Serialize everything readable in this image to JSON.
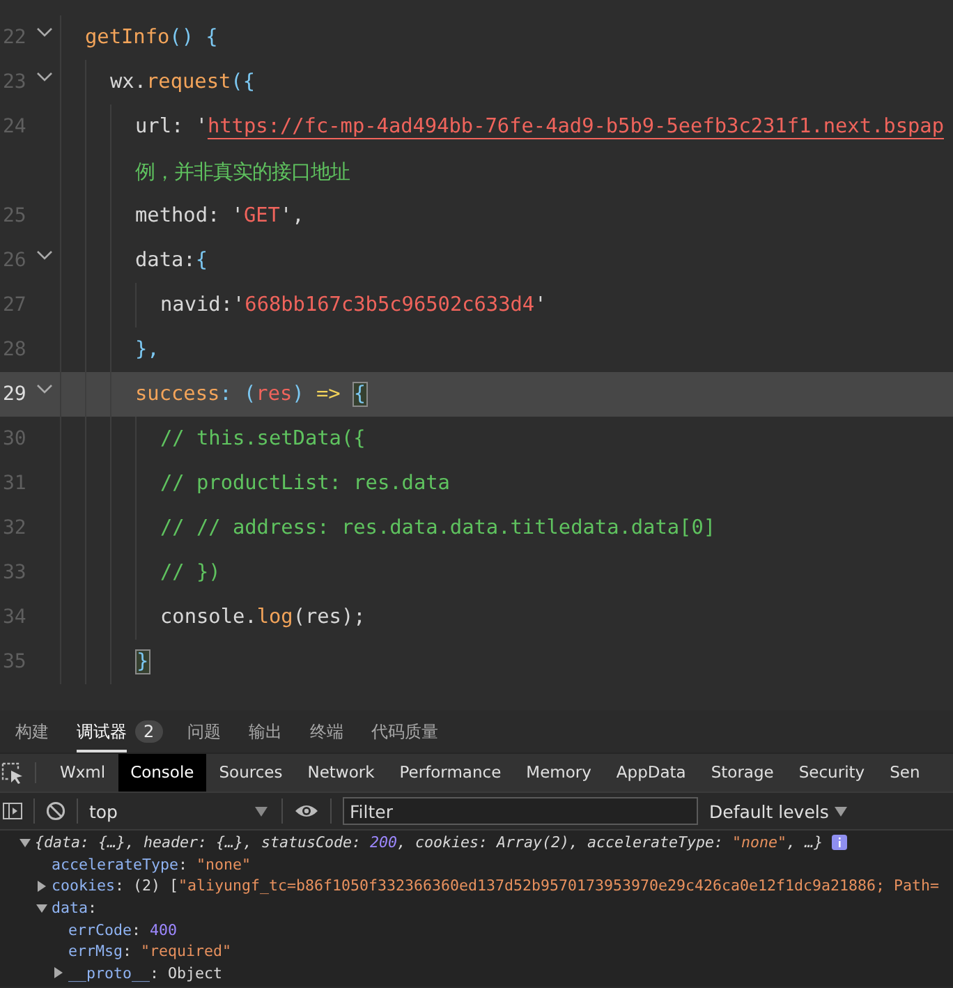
{
  "editor": {
    "lines": [
      {
        "number": "22",
        "fold": true,
        "current": false,
        "tokens": [
          {
            "kind": "fn",
            "text": "getInfo"
          },
          {
            "kind": "punct",
            "text": "() {"
          }
        ],
        "children": [
          {
            "number": "23",
            "fold": true,
            "current": false,
            "tokens": [
              {
                "kind": "plain",
                "text": "wx."
              },
              {
                "kind": "fn",
                "text": "request"
              },
              {
                "kind": "punct",
                "text": "({"
              }
            ],
            "children": [
              {
                "number": "24",
                "fold": false,
                "current": false,
                "tokens": [
                  {
                    "kind": "plain",
                    "text": "url: '"
                  },
                  {
                    "kind": "link",
                    "text": "https://fc-mp-4ad494bb-76fe-4ad9-b5b9-5eefb3c231f1.next.bspap"
                  }
                ]
              },
              {
                "fold": false,
                "current": false,
                "tokens": [
                  {
                    "kind": "comment",
                    "text": "例，并非真实的接口地址"
                  }
                ]
              },
              {
                "number": "25",
                "fold": false,
                "current": false,
                "tokens": [
                  {
                    "kind": "plain",
                    "text": "method: '"
                  },
                  {
                    "kind": "str",
                    "text": "GET"
                  },
                  {
                    "kind": "plain",
                    "text": "',"
                  }
                ]
              },
              {
                "number": "26",
                "fold": true,
                "current": false,
                "tokens": [
                  {
                    "kind": "plain",
                    "text": "data:"
                  },
                  {
                    "kind": "punct",
                    "text": "{"
                  }
                ],
                "children": [
                  {
                    "number": "27",
                    "fold": false,
                    "current": false,
                    "tokens": [
                      {
                        "kind": "plain",
                        "text": "navid:'"
                      },
                      {
                        "kind": "str",
                        "text": "668bb167c3b5c96502c633d4"
                      },
                      {
                        "kind": "plain",
                        "text": "'"
                      }
                    ]
                  }
                ]
              },
              {
                "number": "28",
                "fold": false,
                "current": false,
                "tokens": [
                  {
                    "kind": "punct",
                    "text": "},"
                  }
                ]
              },
              {
                "number": "29",
                "fold": true,
                "current": true,
                "tokens": [
                  {
                    "kind": "fn",
                    "text": "success"
                  },
                  {
                    "kind": "punct",
                    "text": ": ("
                  },
                  {
                    "kind": "str",
                    "text": "res"
                  },
                  {
                    "kind": "punct",
                    "text": ")"
                  },
                  {
                    "kind": "arrow",
                    "text": "=>"
                  },
                  {
                    "kind": "match",
                    "text": "{"
                  }
                ],
                "children": [
                  {
                    "number": "30",
                    "fold": false,
                    "current": false,
                    "tokens": [
                      {
                        "kind": "comment",
                        "text": "// this.setData({"
                      }
                    ]
                  },
                  {
                    "number": "31",
                    "fold": false,
                    "current": false,
                    "tokens": [
                      {
                        "kind": "comment",
                        "text": "//   productList: res.data"
                      }
                    ]
                  },
                  {
                    "number": "32",
                    "fold": false,
                    "current": false,
                    "tokens": [
                      {
                        "kind": "comment",
                        "text": "//   // address: res.data.data.titledata.data[0]"
                      }
                    ]
                  },
                  {
                    "number": "33",
                    "fold": false,
                    "current": false,
                    "tokens": [
                      {
                        "kind": "comment",
                        "text": "// })"
                      }
                    ]
                  },
                  {
                    "number": "34",
                    "fold": false,
                    "current": false,
                    "tokens": [
                      {
                        "kind": "plain",
                        "text": "console."
                      },
                      {
                        "kind": "fn",
                        "text": "log"
                      },
                      {
                        "kind": "plain",
                        "text": "(res);"
                      }
                    ]
                  }
                ]
              },
              {
                "number": "35",
                "fold": false,
                "current": false,
                "tokens": [
                  {
                    "kind": "match",
                    "text": "}"
                  }
                ]
              }
            ]
          }
        ]
      }
    ]
  },
  "panel_tabs": [
    {
      "label": "构建",
      "selected": false
    },
    {
      "label": "调试器",
      "selected": true,
      "badge": "2"
    },
    {
      "label": "问题",
      "selected": false
    },
    {
      "label": "输出",
      "selected": false
    },
    {
      "label": "终端",
      "selected": false
    },
    {
      "label": "代码质量",
      "selected": false
    }
  ],
  "devtools_tabs": [
    {
      "label": "Wxml",
      "selected": false
    },
    {
      "label": "Console",
      "selected": true
    },
    {
      "label": "Sources",
      "selected": false
    },
    {
      "label": "Network",
      "selected": false
    },
    {
      "label": "Performance",
      "selected": false
    },
    {
      "label": "Memory",
      "selected": false
    },
    {
      "label": "AppData",
      "selected": false
    },
    {
      "label": "Storage",
      "selected": false
    },
    {
      "label": "Security",
      "selected": false
    },
    {
      "label": "Sen",
      "selected": false
    }
  ],
  "toolbar": {
    "context": "top",
    "filter": {
      "placeholder": "Filter"
    },
    "levels": "Default levels"
  },
  "console": [
    {
      "expanded": true,
      "italic": true,
      "info": true,
      "tokens": [
        {
          "kind": "plain",
          "text": "{data: {…}, header: {…}, statusCode: "
        },
        {
          "kind": "num",
          "text": "200"
        },
        {
          "kind": "plain",
          "text": ", cookies: Array(2), accelerateType: "
        },
        {
          "kind": "str",
          "text": "\"none\""
        },
        {
          "kind": "plain",
          "text": ", …}"
        }
      ],
      "children": [
        {
          "key": "accelerateType",
          "tokens": [
            {
              "kind": "plain",
              "text": ": "
            },
            {
              "kind": "str",
              "text": "\"none\""
            }
          ]
        },
        {
          "expanded": false,
          "key": "cookies",
          "tokens": [
            {
              "kind": "plain",
              "text": ": (2) ["
            },
            {
              "kind": "str",
              "text": "\"aliyungf_tc=b86f1050f332366360ed137d52b9570173953970e29c426ca0e12f1dc9a21886; Path="
            }
          ]
        },
        {
          "expanded": true,
          "key": "data",
          "tokens": [
            {
              "kind": "plain",
              "text": ":"
            }
          ],
          "children": [
            {
              "key": "errCode",
              "tokens": [
                {
                  "kind": "plain",
                  "text": ": "
                },
                {
                  "kind": "num",
                  "text": "400"
                }
              ]
            },
            {
              "key": "errMsg",
              "tokens": [
                {
                  "kind": "plain",
                  "text": ": "
                },
                {
                  "kind": "str",
                  "text": "\"required\""
                }
              ]
            },
            {
              "expanded": false,
              "key": "__proto__",
              "tokens": [
                {
                  "kind": "plain",
                  "text": ": Object"
                }
              ]
            }
          ]
        }
      ]
    }
  ]
}
